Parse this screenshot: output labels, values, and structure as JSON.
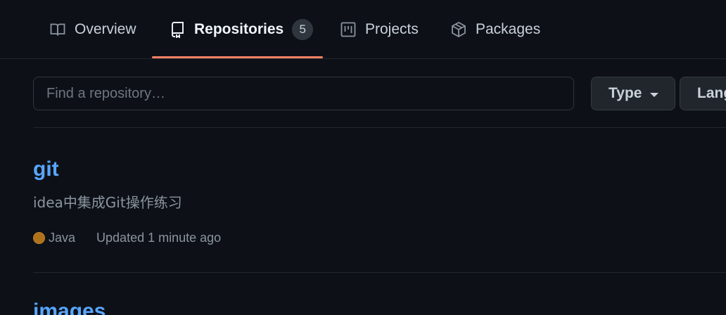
{
  "tabs": [
    {
      "label": "Overview",
      "icon": "book-icon"
    },
    {
      "label": "Repositories",
      "icon": "repo-icon",
      "count": "5",
      "selected": true
    },
    {
      "label": "Projects",
      "icon": "project-icon"
    },
    {
      "label": "Packages",
      "icon": "package-icon"
    }
  ],
  "filters": {
    "search_placeholder": "Find a repository…",
    "type_label": "Type",
    "language_label": "Language"
  },
  "repos": [
    {
      "name": "git",
      "description": "idea中集成Git操作练习",
      "language": "Java",
      "language_color": "#b07219",
      "updated": "Updated 1 minute ago"
    },
    {
      "name": "images"
    }
  ],
  "colors": {
    "accent_underline": "#f78166",
    "link": "#58a6ff",
    "background": "#0d1117"
  }
}
